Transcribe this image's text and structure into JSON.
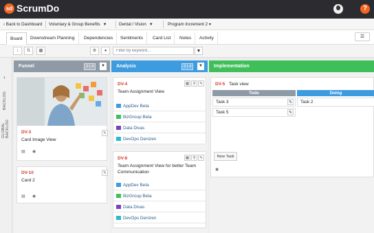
{
  "app": {
    "name": "ScrumDo",
    "logo_mark": "sd",
    "accent_color": "#f26522",
    "help_label": "?"
  },
  "breadcrumbs": {
    "back": "‹ Back to Dashboard",
    "project": "Voluntary & Group Benefits",
    "team": "Dental / Vision",
    "increment": "Program Increment 2 ▾"
  },
  "tabs": [
    "Board",
    "Downstream Planning",
    "Dependencies",
    "Sentiments",
    "Card List",
    "Notes",
    "Activity"
  ],
  "active_tab": "Board",
  "toolbar": {
    "filter_placeholder": "Filter by keyword..."
  },
  "sidebar": {
    "backlog": "BACKLOG",
    "global_backlog": "GLOBAL BACKLOG"
  },
  "columns": [
    {
      "title": "Funnel",
      "wip": "2 | 4",
      "color": "#8e9aa6",
      "cards": [
        {
          "id": "DV-3",
          "title": "Card Image View",
          "has_image": true
        },
        {
          "id": "DV-10",
          "title": "Card 2"
        }
      ]
    },
    {
      "title": "Analysis",
      "wip": "2 | 4",
      "color": "#3d9be0",
      "cards": [
        {
          "id": "DV-4",
          "title": "Team Assignment View",
          "teams": [
            "AppDev Beta",
            "BizGroup Beta",
            "Data Divas",
            "DevOps Denizen"
          ]
        },
        {
          "id": "DV-8",
          "title": "Team Assignment View for better Team Communication",
          "teams": [
            "AppDev Beta",
            "BizGroup Beta",
            "Data Divas",
            "DevOps Denizen"
          ]
        }
      ]
    },
    {
      "title": "Implementation",
      "color": "#3fbf5a",
      "cards": [
        {
          "id": "DV-5",
          "title": "Task view",
          "subcolumns": [
            {
              "title": "Todo",
              "color": "#8e9aa6",
              "tasks": [
                "Task 3",
                "Task 5"
              ]
            },
            {
              "title": "Doing",
              "color": "#3d9be0",
              "tasks": [
                "Task 2"
              ]
            }
          ],
          "new_task": "New Task"
        }
      ]
    }
  ],
  "team_colors": {
    "AppDev Beta": "#3d9be0",
    "BizGroup Beta": "#3fbf5a",
    "Data Divas": "#7b3fbf",
    "DevOps Denizen": "#2fb8c9"
  }
}
